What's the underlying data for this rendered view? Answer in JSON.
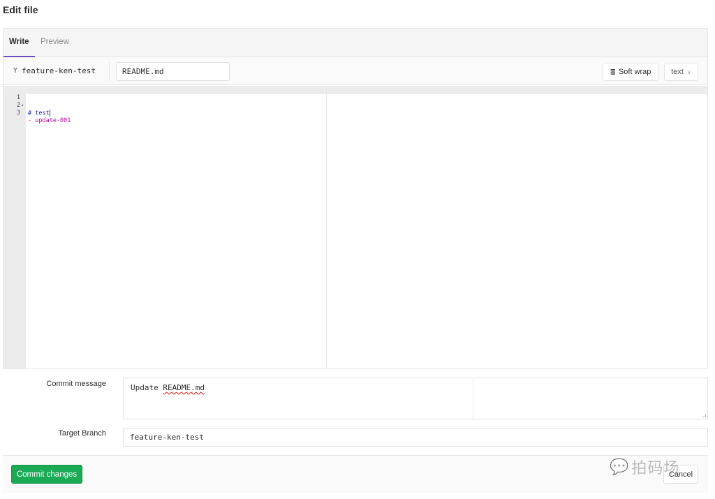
{
  "page": {
    "title": "Edit file"
  },
  "tabs": [
    {
      "label": "Write",
      "active": true
    },
    {
      "label": "Preview",
      "active": false
    }
  ],
  "file_bar": {
    "branch_icon": "fork-icon",
    "branch_glyph": "Y",
    "branch_name": "feature-ken-test",
    "filename": "README.md",
    "soft_wrap_label": "Soft wrap",
    "soft_wrap_glyph": "≣",
    "language_label": "text",
    "chevron_glyph": "∨"
  },
  "editor": {
    "lines": [
      {
        "number": "1",
        "fold": "▾",
        "text": "# test",
        "kind": "heading"
      },
      {
        "number": "2",
        "fold": "",
        "text": "",
        "kind": "plain"
      },
      {
        "number": "3",
        "fold": "",
        "text": "- update-001",
        "kind": "list"
      }
    ]
  },
  "commit": {
    "message_label": "Commit message",
    "message_prefix": "Update ",
    "message_misspelled": "README.md",
    "branch_label": "Target Branch",
    "branch_value": "feature-ken-test"
  },
  "actions": {
    "commit_label": "Commit changes",
    "cancel_label": "Cancel"
  },
  "watermark": {
    "icon_glyph": "💬",
    "text": "拍码场"
  }
}
